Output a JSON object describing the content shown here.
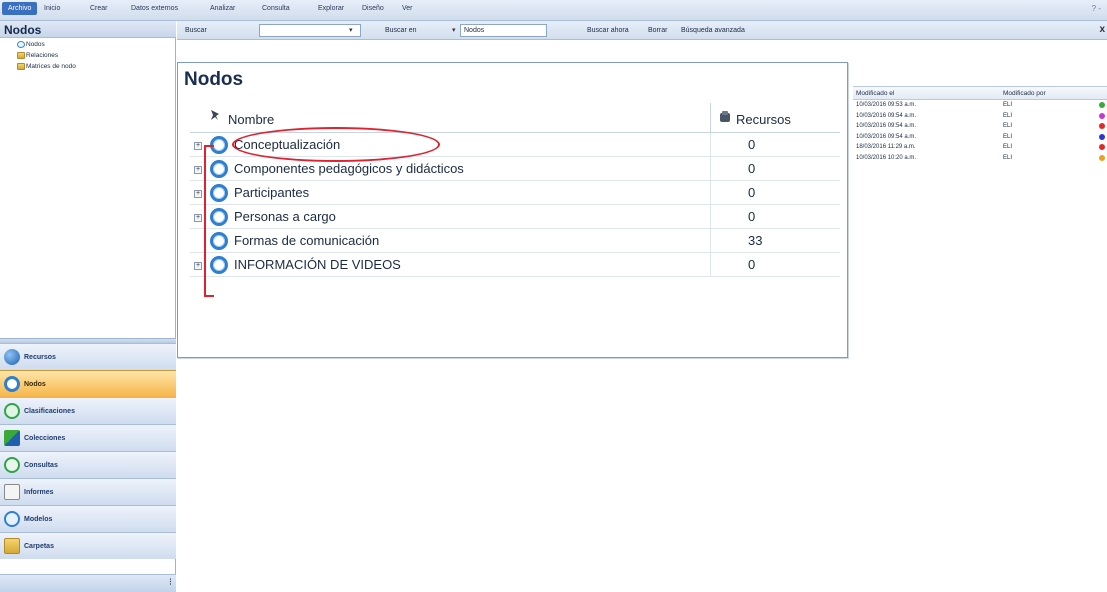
{
  "ribbon": {
    "tabs": [
      "Archivo",
      "Inicio",
      "Crear",
      "Datos externos",
      "Analizar",
      "Consulta",
      "Explorar",
      "Diseño",
      "Ver"
    ],
    "right": "? -"
  },
  "left_pane": {
    "title": "Nodos",
    "tree": [
      "Nodos",
      "Relaciones",
      "Matrices de nodo"
    ],
    "nav": [
      "Recursos",
      "Nodos",
      "Clasificaciones",
      "Colecciones",
      "Consultas",
      "Informes",
      "Modelos",
      "Carpetas"
    ],
    "active_nav": "Nodos"
  },
  "search_bar": {
    "buscar_label": "Buscar",
    "search_value": "",
    "buscar_en_label": "Buscar en",
    "scope_value": "Nodos",
    "buscar_ahora": "Buscar ahora",
    "borrar": "Borrar",
    "busqueda_avanzada": "Búsqueda avanzada",
    "close": "x"
  },
  "right_list": {
    "headers": {
      "modificado_el": "Modificado el",
      "modificado_por": "Modificado por"
    },
    "rows": [
      {
        "date": "10/03/2016 09:53 a.m.",
        "by": "ELI",
        "color": "#3aa83a"
      },
      {
        "date": "10/03/2016 09:54 a.m.",
        "by": "ELI",
        "color": "#c43ad0"
      },
      {
        "date": "10/03/2016 09:54 a.m.",
        "by": "ELI",
        "color": "#e02a2a"
      },
      {
        "date": "10/03/2016 09:54 a.m.",
        "by": "ELI",
        "color": "#2a3ad0"
      },
      {
        "date": "18/03/2016 11:29 a.m.",
        "by": "ELI",
        "color": "#e02a2a"
      },
      {
        "date": "10/03/2016 10:20 a.m.",
        "by": "ELI",
        "color": "#f0a020"
      }
    ]
  },
  "panel": {
    "title": "Nodos",
    "col_name": "Nombre",
    "col_resources": "Recursos",
    "rows": [
      {
        "name": "Conceptualización",
        "count": "0",
        "expandable": true
      },
      {
        "name": "Componentes pedagógicos y didácticos",
        "count": "0",
        "expandable": true
      },
      {
        "name": "Participantes",
        "count": "0",
        "expandable": true
      },
      {
        "name": "Personas a cargo",
        "count": "0",
        "expandable": true
      },
      {
        "name": "Formas de comunicación",
        "count": "33",
        "expandable": false
      },
      {
        "name": "INFORMACIÓN DE VIDEOS",
        "count": "0",
        "expandable": true
      }
    ]
  },
  "colors": {
    "accent": "#3b6fc0",
    "active_nav": "#f7b54a",
    "annotation": "#e0212f",
    "node_ring": "#2f7fd0"
  }
}
